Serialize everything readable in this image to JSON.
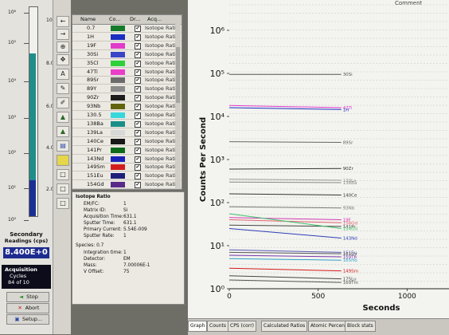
{
  "gauge": {
    "log_ticks": [
      {
        "label": "10⁶",
        "y": 10
      },
      {
        "label": "10⁵",
        "y": 48
      },
      {
        "label": "10⁴",
        "y": 96
      },
      {
        "label": "10³",
        "y": 142
      },
      {
        "label": "10²",
        "y": 186
      },
      {
        "label": "10¹",
        "y": 230
      },
      {
        "label": "10⁰",
        "y": 270
      }
    ],
    "linear_ticks": [
      {
        "label": "10.0",
        "y": 20
      },
      {
        "label": "8.0",
        "y": 74
      },
      {
        "label": "6.0",
        "y": 128
      },
      {
        "label": "4.0",
        "y": 180
      },
      {
        "label": "2.0",
        "y": 232
      }
    ],
    "teal_level": 0.78,
    "blue_level": 0.17,
    "secondary_label": "Secondary",
    "readings_label": "Readings (cps)",
    "reading_value": "8.400E+0",
    "acquisition_label": "Acquisition",
    "cycles_label": "Cycles",
    "cycles_value": "84 of 10"
  },
  "buttons": {
    "stop": "Stop",
    "abort": "Abort",
    "setup": "Setup..."
  },
  "toolbar_icons": [
    "arrow-left-icon",
    "arrow-right-icon",
    "zoom-icon",
    "move-icon",
    "text-icon",
    "pencil-icon",
    "pencil2-icon",
    "peak-icon",
    "peak2-icon",
    "area-icon",
    "yellow-box-icon",
    "blank-box-icon",
    "blank-box2-icon",
    "blank-box3-icon"
  ],
  "table": {
    "headers": [
      "Name",
      "Co...",
      "Dr...",
      "Acq..."
    ],
    "rows": [
      {
        "name": "0.7",
        "color": "#157a2a",
        "acq": "Isotope Rati"
      },
      {
        "name": "1H",
        "color": "#1a2fc0",
        "acq": "Isotope Rati"
      },
      {
        "name": "19F",
        "color": "#e23acb",
        "acq": "Isotope Rati"
      },
      {
        "name": "30Si",
        "color": "#3b44c6",
        "acq": "Isotope Rati"
      },
      {
        "name": "35Cl",
        "color": "#2ed13a",
        "acq": "Isotope Rati"
      },
      {
        "name": "47Ti",
        "color": "#ea3ec9",
        "acq": "Isotope Rati"
      },
      {
        "name": "89Sr",
        "color": "#6b6b6b",
        "acq": "Isotope Rati"
      },
      {
        "name": "89Y",
        "color": "#8a8a8a",
        "acq": "Isotope Rati"
      },
      {
        "name": "90Zr",
        "color": "#1d1d1d",
        "acq": "Isotope Rati"
      },
      {
        "name": "93Nb",
        "color": "#63630f",
        "acq": "Isotope Rati"
      },
      {
        "name": "130.5",
        "color": "#37d7db",
        "acq": "Isotope Rati"
      },
      {
        "name": "138Ba",
        "color": "#1a8f88",
        "acq": "Isotope Rati"
      },
      {
        "name": "139La",
        "color": "#d8d8d8",
        "acq": "Isotope Rati"
      },
      {
        "name": "140Ce",
        "color": "#181818",
        "acq": "Isotope Rati"
      },
      {
        "name": "141Pr",
        "color": "#0d6a1b",
        "acq": "Isotope Rati"
      },
      {
        "name": "143Nd",
        "color": "#1a21b8",
        "acq": "Isotope Rati"
      },
      {
        "name": "149Sm",
        "color": "#d21c1c",
        "acq": "Isotope Rati"
      },
      {
        "name": "151Eu",
        "color": "#1f1f7a",
        "acq": "Isotope Rati"
      },
      {
        "name": "154Gd",
        "color": "#5a2a8a",
        "acq": "Isotope Rati"
      }
    ]
  },
  "details": {
    "title": "Isotope Ratio",
    "rows": [
      {
        "k": "EM/FC:",
        "v": "1"
      },
      {
        "k": "Matrix ID:",
        "v": "Si"
      },
      {
        "k": "Acquisition Time:",
        "v": "631.1"
      },
      {
        "k": "Sputter Time:",
        "v": "631.1"
      },
      {
        "k": "Primary Current:",
        "v": "5.54E-009"
      },
      {
        "k": "Sputter Rate:",
        "v": "1"
      }
    ],
    "species_label": "Species: 0.7",
    "species_rows": [
      {
        "k": "Integration time:",
        "v": "1"
      },
      {
        "k": "Detector:",
        "v": "EM"
      },
      {
        "k": "Mass:",
        "v": "7.00006E-1"
      },
      {
        "k": "V Offset:",
        "v": "75"
      }
    ]
  },
  "chart": {
    "comment_label": "Comment",
    "ylabel": "Counts Per Second",
    "xlabel": "Seconds",
    "y_tick_labels": [
      "10⁰",
      "10¹",
      "10²",
      "10³",
      "10⁴",
      "10⁵",
      "10⁶"
    ],
    "x_tick_labels": [
      "0",
      "500",
      "1000"
    ]
  },
  "chart_data": {
    "type": "line",
    "title": "",
    "xlabel": "Seconds",
    "ylabel": "Counts Per Second",
    "y_scale": "log",
    "xlim": [
      0,
      1200
    ],
    "ylim": [
      1,
      1000000
    ],
    "grid": true,
    "series": [
      {
        "name": "30Si",
        "color": "#555555",
        "x": [
          0,
          630
        ],
        "y": [
          95000,
          95000
        ]
      },
      {
        "name": "47Ti",
        "color": "#e23acb",
        "x": [
          0,
          630
        ],
        "y": [
          18000,
          16000
        ]
      },
      {
        "name": "1H",
        "color": "#1a2fc0",
        "x": [
          0,
          630
        ],
        "y": [
          16000,
          14500
        ]
      },
      {
        "name": "89Sr",
        "color": "#666666",
        "x": [
          0,
          630
        ],
        "y": [
          2600,
          2500
        ]
      },
      {
        "name": "90Zr",
        "color": "#333333",
        "x": [
          0,
          630
        ],
        "y": [
          600,
          620
        ]
      },
      {
        "name": "139La",
        "color": "#999999",
        "x": [
          0,
          630
        ],
        "y": [
          350,
          330
        ]
      },
      {
        "name": "138Ba",
        "color": "#888888",
        "x": [
          0,
          630
        ],
        "y": [
          300,
          290
        ]
      },
      {
        "name": "140Ce",
        "color": "#333333",
        "x": [
          0,
          630
        ],
        "y": [
          160,
          150
        ]
      },
      {
        "name": "93Nb",
        "color": "#777777",
        "x": [
          0,
          630
        ],
        "y": [
          80,
          75
        ]
      },
      {
        "name": "19F",
        "color": "#d03ab0",
        "x": [
          0,
          630
        ],
        "y": [
          45,
          40
        ]
      },
      {
        "name": "156Gd",
        "color": "#e06070",
        "x": [
          0,
          630
        ],
        "y": [
          40,
          34
        ]
      },
      {
        "name": "141Pr",
        "color": "#444444",
        "x": [
          0,
          630
        ],
        "y": [
          30,
          28
        ]
      },
      {
        "name": "154Gd",
        "color": "#3ec16a",
        "x": [
          0,
          630
        ],
        "y": [
          55,
          25
        ]
      },
      {
        "name": "143Nd",
        "color": "#2d3db8",
        "x": [
          0,
          630
        ],
        "y": [
          25,
          15
        ]
      },
      {
        "name": "151Eu",
        "color": "#5a5ab8",
        "x": [
          0,
          630
        ],
        "y": [
          8,
          7
        ]
      },
      {
        "name": "161Dy",
        "color": "#555555",
        "x": [
          0,
          630
        ],
        "y": [
          7,
          6.5
        ]
      },
      {
        "name": "159Tb",
        "color": "#7b3bb0",
        "x": [
          0,
          630
        ],
        "y": [
          6,
          5.5
        ]
      },
      {
        "name": "165Ho",
        "color": "#2ea1c8",
        "x": [
          0,
          630
        ],
        "y": [
          5,
          4.6
        ]
      },
      {
        "name": "149Sm",
        "color": "#d21c1c",
        "x": [
          0,
          630
        ],
        "y": [
          3,
          2.6
        ]
      },
      {
        "name": "175Lu",
        "color": "#444444",
        "x": [
          0,
          630
        ],
        "y": [
          2,
          1.7
        ]
      },
      {
        "name": "169Tm",
        "color": "#555555",
        "x": [
          0,
          630
        ],
        "y": [
          1.6,
          1.4
        ]
      }
    ]
  },
  "tabs": [
    "Graph",
    "Counts",
    "CPS (corr)",
    "Calculated Ratios",
    "Atomic Percent",
    "Block stats"
  ]
}
